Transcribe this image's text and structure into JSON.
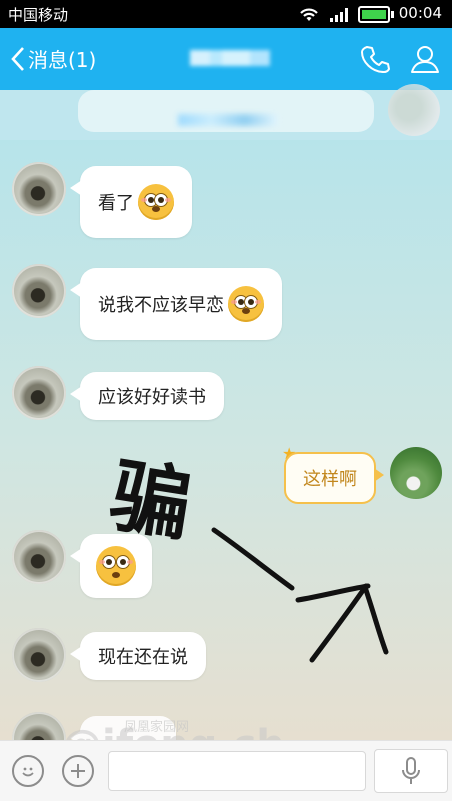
{
  "status_bar": {
    "carrier": "中国移动",
    "time": "00:04"
  },
  "header": {
    "back_label": "消息(1)"
  },
  "messages": [
    {
      "side": "left",
      "text": "看了",
      "emoji": true
    },
    {
      "side": "left",
      "text": "说我不应该早恋",
      "emoji": true
    },
    {
      "side": "left",
      "text": "应该好好读书",
      "emoji": false
    },
    {
      "side": "right",
      "text": "这样啊",
      "emoji": false
    },
    {
      "side": "left",
      "text": "",
      "emoji": true
    },
    {
      "side": "left",
      "text": "现在还在说",
      "emoji": false
    }
  ],
  "annotation": {
    "handwriting": "骗"
  },
  "watermark": {
    "main": "@ifeng.ch",
    "sub": "凤凰家园网"
  },
  "colors": {
    "header": "#1fb2f0",
    "accent_bubble_border": "#f5c04b"
  },
  "icons": [
    "chevron-left-icon",
    "phone-icon",
    "contact-icon",
    "emoji-icon",
    "plus-icon",
    "microphone-icon",
    "wifi-icon",
    "signal-icon",
    "battery-icon"
  ]
}
